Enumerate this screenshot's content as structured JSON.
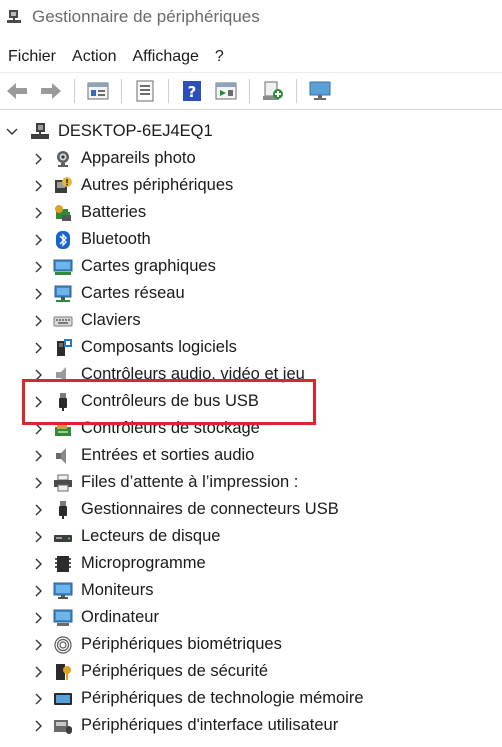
{
  "window": {
    "title": "Gestionnaire de périphériques"
  },
  "menu": [
    "Fichier",
    "Action",
    "Affichage",
    "?"
  ],
  "toolbar": [
    "back-icon",
    "forward-icon",
    "properties-icon",
    "update-icon",
    "help-icon",
    "panel-icon",
    "scan-icon",
    "monitor-icon"
  ],
  "tree": {
    "root": "DESKTOP-6EJ4EQ1",
    "items": [
      {
        "label": "Appareils photo",
        "icon": "camera-icon"
      },
      {
        "label": "Autres périphériques",
        "icon": "unknown-device-icon"
      },
      {
        "label": "Batteries",
        "icon": "battery-icon"
      },
      {
        "label": "Bluetooth",
        "icon": "bluetooth-icon"
      },
      {
        "label": "Cartes graphiques",
        "icon": "display-adapter-icon"
      },
      {
        "label": "Cartes réseau",
        "icon": "network-adapter-icon"
      },
      {
        "label": "Claviers",
        "icon": "keyboard-icon"
      },
      {
        "label": "Composants logiciels",
        "icon": "software-component-icon"
      },
      {
        "label": "Contrôleurs audio, vidéo et jeu",
        "icon": "audio-icon"
      },
      {
        "label": "Contrôleurs de bus USB",
        "icon": "usb-icon"
      },
      {
        "label": "Contrôleurs de stockage",
        "icon": "storage-icon"
      },
      {
        "label": "Entrées et sorties audio",
        "icon": "speaker-icon"
      },
      {
        "label": "Files d’attente à l’impression :",
        "icon": "printer-icon"
      },
      {
        "label": "Gestionnaires de connecteurs USB",
        "icon": "usb-connector-icon"
      },
      {
        "label": "Lecteurs de disque",
        "icon": "disk-drive-icon"
      },
      {
        "label": "Microprogramme",
        "icon": "firmware-icon"
      },
      {
        "label": "Moniteurs",
        "icon": "monitor-icon"
      },
      {
        "label": "Ordinateur",
        "icon": "computer-icon"
      },
      {
        "label": "Périphériques biométriques",
        "icon": "fingerprint-icon"
      },
      {
        "label": "Périphériques de sécurité",
        "icon": "security-key-icon"
      },
      {
        "label": "Périphériques de technologie mémoire",
        "icon": "memory-icon"
      },
      {
        "label": "Périphériques d'interface utilisateur",
        "icon": "hid-icon"
      }
    ]
  },
  "colors": {
    "highlight": "#e0242b"
  }
}
